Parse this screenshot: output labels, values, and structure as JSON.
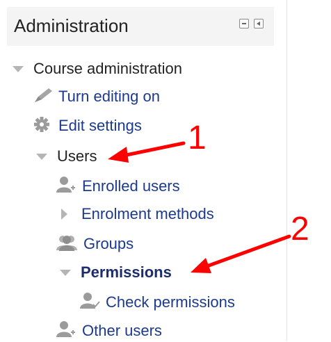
{
  "block": {
    "title": "Administration"
  },
  "tree": {
    "course_admin": "Course administration",
    "turn_editing_on": "Turn editing on",
    "edit_settings": "Edit settings",
    "users": "Users",
    "enrolled_users": "Enrolled users",
    "enrolment_methods": "Enrolment methods",
    "groups": "Groups",
    "permissions": "Permissions",
    "check_permissions": "Check permissions",
    "other_users": "Other users"
  },
  "annotations": {
    "one": "1",
    "two": "2"
  },
  "icons": {
    "expanded": "triangle-down-icon",
    "collapsed": "triangle-right-icon",
    "edit": "pencil-icon",
    "settings": "gear-icon",
    "user": "user-icon",
    "group": "group-icon"
  },
  "colors": {
    "link": "#1c3a8c",
    "active": "#1c2d6e",
    "arrow": "#ff0000",
    "header_bg": "#f4f4f4",
    "triangle": "#b5b5b5"
  }
}
